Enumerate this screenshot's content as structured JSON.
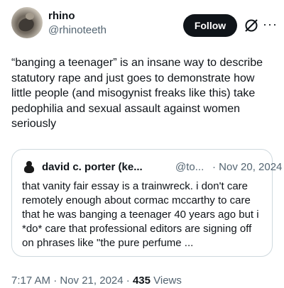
{
  "author": {
    "display_name": "rhino",
    "handle": "@rhinoteeth",
    "avatar_icon": "profile-photo"
  },
  "actions": {
    "follow_label": "Follow",
    "grok_icon": "grok-slash-icon",
    "more_icon": "ellipsis-icon",
    "more_glyph": "···"
  },
  "tweet": {
    "text": "“banging a teenager” is an insane way to describe statutory rape and just goes to demonstrate how little people (and misogynist freaks like this) take pedophilia and sexual assault against women seriously"
  },
  "quoted_tweet": {
    "display_name": "david c. porter (ke...",
    "handle": "@to...",
    "date": "· Nov 20, 2024",
    "text": "that vanity fair essay is a trainwreck. i don't care remotely enough about cormac mccarthy to care that he was banging a teenager 40 years ago but i *do* care that professional editors are signing off on phrases like \"the pure perfume ..."
  },
  "meta": {
    "time": "7:17 AM · Nov 21, 2024 ·",
    "views_count": "435",
    "views_label": "Views"
  },
  "colors": {
    "text": "#0f1419",
    "secondary": "#536471",
    "border": "#cfd9de",
    "button_bg": "#0f1419"
  }
}
